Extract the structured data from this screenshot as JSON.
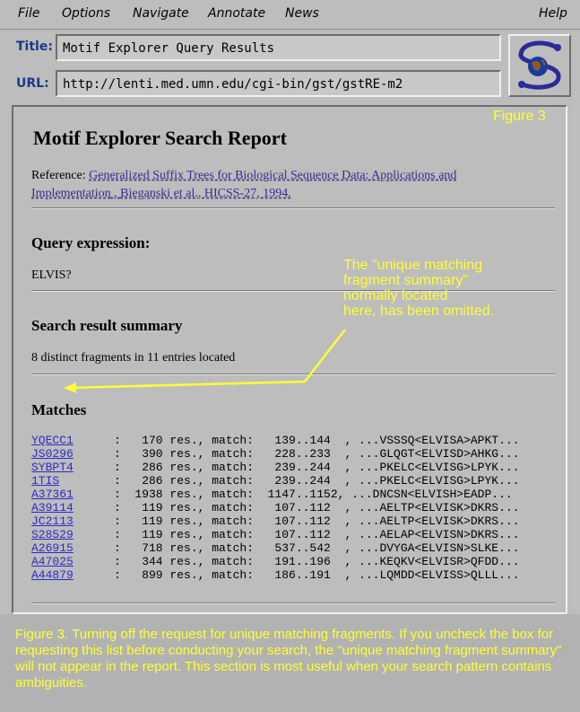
{
  "menu": {
    "file": "File",
    "options": "Options",
    "navigate": "Navigate",
    "annotate": "Annotate",
    "news": "News",
    "help": "Help"
  },
  "title_label": "Title:",
  "title_value": "Motif Explorer Query Results",
  "url_label": "URL:",
  "url_value": "http://lenti.med.umn.edu/cgi-bin/gst/gstRE-m2",
  "logo_icon": "globe-s-logo-icon",
  "figure_label": "Figure 3",
  "report": {
    "heading": "Motif Explorer Search Report",
    "reference_prefix": "Reference: ",
    "reference_link": "Generalized Suffix Trees for Biological Sequence Data: Applications and",
    "reference_link2": "Implementation",
    "reference_sep": " , ",
    "reference_author": "Bieganski et al., HICSS-27, 1994.",
    "query_heading": "Query expression:",
    "query_value": "ELVIS?",
    "summary_heading": "Search result summary",
    "summary_value": "8 distinct fragments in 11 entries located",
    "matches_heading": "Matches"
  },
  "annotation": "The \"unique matching fragment summary\" normally located here, has been omitted.",
  "annotation_lines": [
    "The \"unique matching",
    "fragment summary\"",
    "normally located",
    "here, has been omitted."
  ],
  "matches": [
    {
      "id": "YQECC1",
      "rest": ":   170 res., match:   139..144  , ...VSSSQ<ELVISA>APKT..."
    },
    {
      "id": "JS0296",
      "rest": ":   390 res., match:   228..233  , ...GLQGT<ELVISD>AHKG..."
    },
    {
      "id": "SYBPT4",
      "rest": ":   286 res., match:   239..244  , ...PKELC<ELVISG>LPYK..."
    },
    {
      "id": "1TIS",
      "rest": ":   286 res., match:   239..244  , ...PKELC<ELVISG>LPYK..."
    },
    {
      "id": "A37361",
      "rest": ":  1938 res., match:  1147..1152, ...DNCSN<ELVISH>EADP..."
    },
    {
      "id": "A39114",
      "rest": ":   119 res., match:   107..112  , ...AELTP<ELVISK>DKRS..."
    },
    {
      "id": "JC2113",
      "rest": ":   119 res., match:   107..112  , ...AELTP<ELVISK>DKRS..."
    },
    {
      "id": "S28529",
      "rest": ":   119 res., match:   107..112  , ...AELAP<ELVISN>DKRS..."
    },
    {
      "id": "A26915",
      "rest": ":   718 res., match:   537..542  , ...DVYGA<ELVISN>SLKE..."
    },
    {
      "id": "A47025",
      "rest": ":   344 res., match:   191..196  , ...KEQKV<ELVISR>QFDD..."
    },
    {
      "id": "A44879",
      "rest": ":   899 res., match:   186..191  , ...LQMDD<ELVISS>QLLL..."
    }
  ],
  "caption": "Figure 3.  Turning off the request for unique matching fragments.  If you uncheck the box for requesting this list before conducting your search, the \"unique matching fragment summary\" will not appear in the report.  This section is most useful when your search pattern contains ambiguities.",
  "colors": {
    "annotation": "#ffff33",
    "link": "#3a2a8e",
    "background": "#bdbdbd"
  }
}
